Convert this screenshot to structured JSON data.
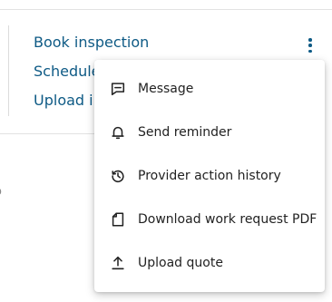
{
  "actions": {
    "book_inspection": "Book inspection",
    "schedule": "Schedule",
    "upload": "Upload i"
  },
  "background_text": "o",
  "menu": {
    "items": [
      {
        "label": "Message",
        "icon": "message-icon"
      },
      {
        "label": "Send reminder",
        "icon": "bell-icon"
      },
      {
        "label": "Provider action history",
        "icon": "history-icon"
      },
      {
        "label": "Download work request PDF",
        "icon": "document-icon"
      },
      {
        "label": "Upload quote",
        "icon": "upload-icon"
      }
    ]
  },
  "colors": {
    "link": "#0e5a85",
    "text": "#222222"
  }
}
